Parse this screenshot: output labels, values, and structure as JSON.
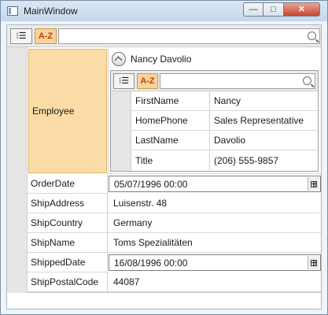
{
  "window": {
    "title": "MainWindow",
    "minimize_glyph": "—",
    "maximize_glyph": "□",
    "close_glyph": "✕"
  },
  "toolbar": {
    "categorized_label": "⁝☰",
    "alphabetical_label": "A-Z",
    "search_value": ""
  },
  "employee": {
    "label": "Employee",
    "value": "Nancy Davolio",
    "toolbar": {
      "categorized_label": "⁝☰",
      "alphabetical_label": "A-Z",
      "search_value": ""
    },
    "properties": [
      {
        "name": "FirstName",
        "value": "Nancy"
      },
      {
        "name": "HomePhone",
        "value": "Sales Representative"
      },
      {
        "name": "LastName",
        "value": "Davolio"
      },
      {
        "name": "Title",
        "value": "(206) 555-9857"
      }
    ]
  },
  "properties": [
    {
      "name": "OrderDate",
      "value": "05/07/1996 00:00",
      "editor": "date"
    },
    {
      "name": "ShipAddress",
      "value": "Luisenstr. 48"
    },
    {
      "name": "ShipCountry",
      "value": "Germany"
    },
    {
      "name": "ShipName",
      "value": "Toms Spezialitäten"
    },
    {
      "name": "ShippedDate",
      "value": "16/08/1996 00:00",
      "editor": "date"
    },
    {
      "name": "ShipPostalCode",
      "value": "44087"
    }
  ],
  "colors": {
    "selected_button": "#f7d49a",
    "selected_button_text": "#c23b1a",
    "employee_highlight": "#fbdca6",
    "left_gutter": "#e6e6e6"
  }
}
